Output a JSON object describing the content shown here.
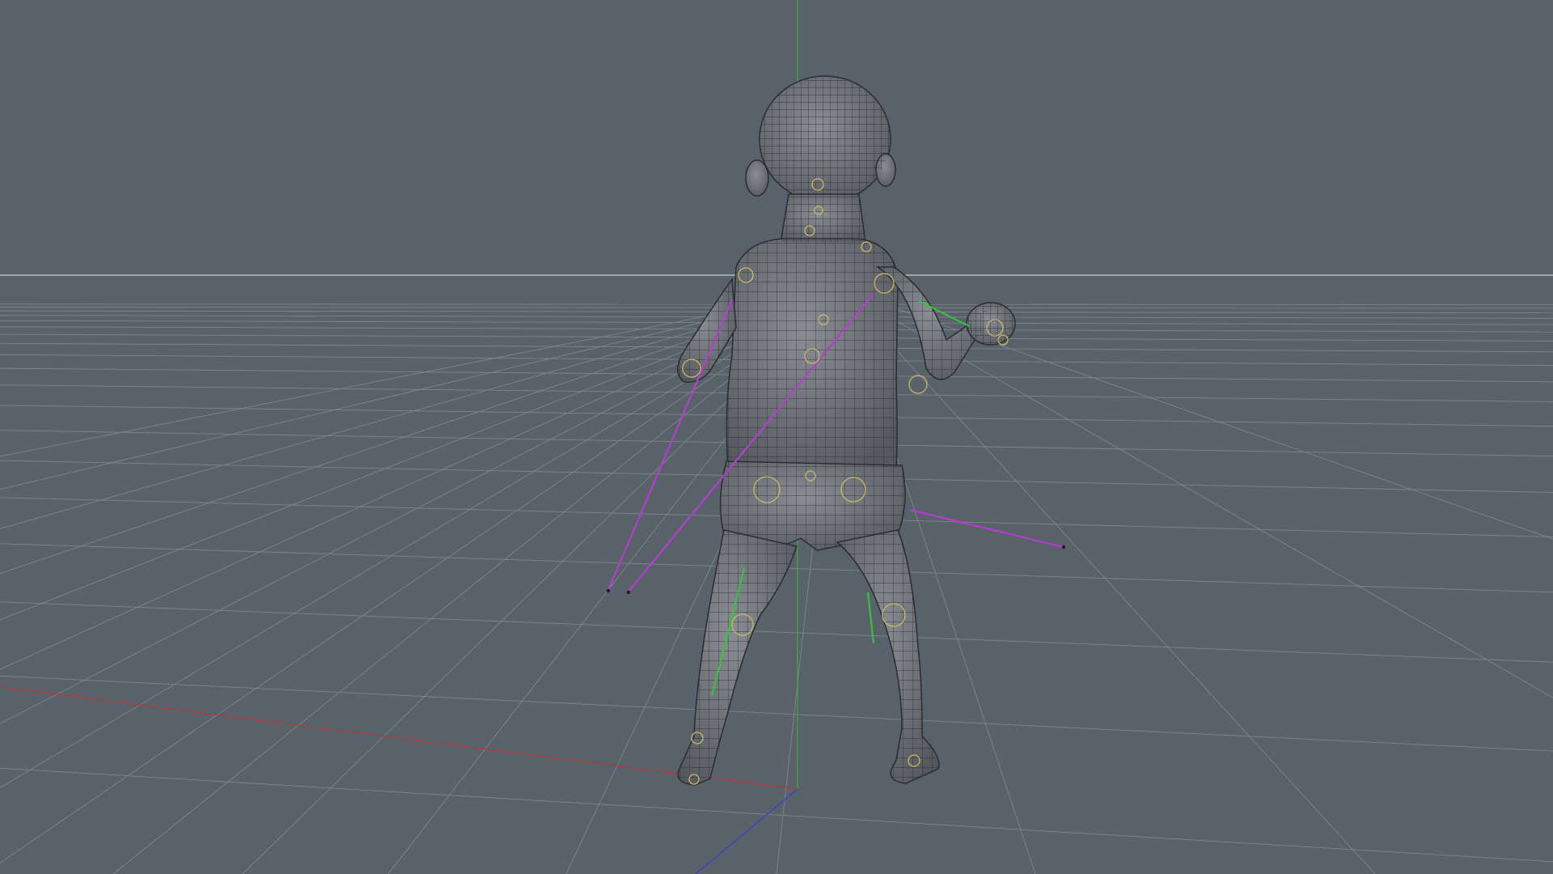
{
  "viewport": {
    "view": "perspective",
    "background_color": "#59616a",
    "grid": {
      "visible": true,
      "line_color": "#7e868e",
      "horizon_color": "#c9ced3"
    },
    "axes": {
      "x_color": "#b23a32",
      "y_color": "#2fb92f",
      "z_color": "#3b3fd0"
    }
  },
  "scene": {
    "model": {
      "subject": "baby-figure",
      "display": "shaded-with-wireframe",
      "shade_color": "#707479",
      "wire_color": "#202325"
    },
    "rig": {
      "joint_color": "#c8b86a",
      "ik_line_color": "#b23fce",
      "bone_line_color": "#32c83a"
    }
  }
}
